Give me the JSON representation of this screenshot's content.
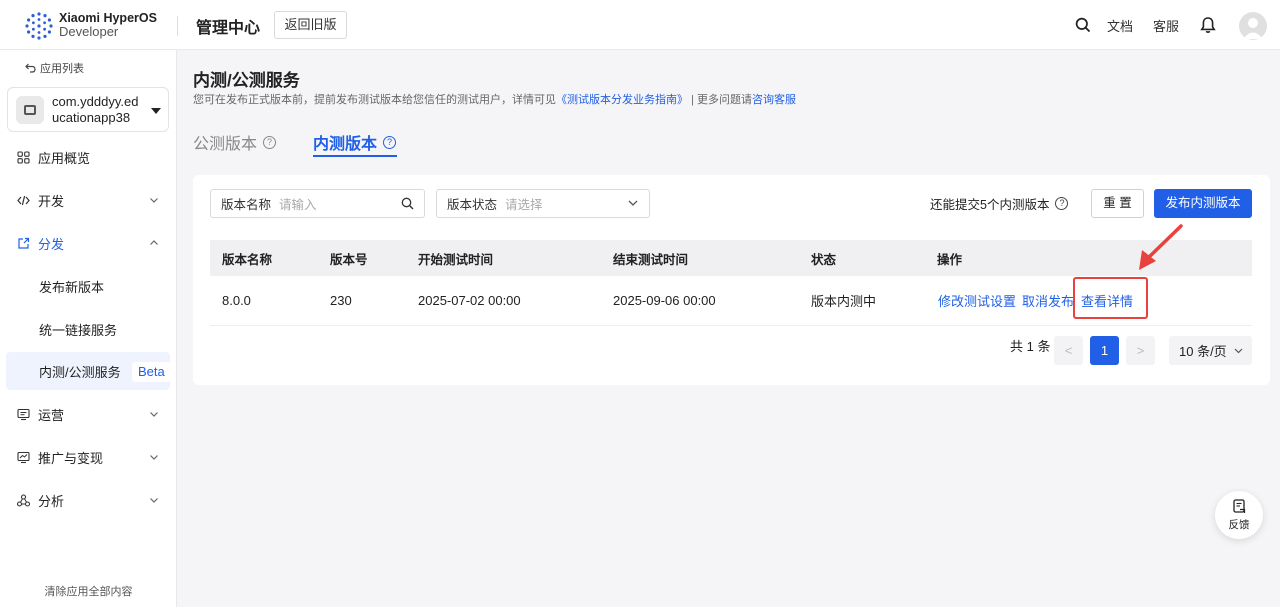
{
  "header": {
    "logo_line1": "Xiaomi HyperOS",
    "logo_line2": "Developer",
    "brand": "管理中心",
    "old_version_button": "返回旧版",
    "docs": "文档",
    "support": "客服"
  },
  "sidebar": {
    "back": "应用列表",
    "app_name_line1": "com.ydddyy.ed",
    "app_name_line2": "ucationapp38",
    "items": [
      {
        "label": "应用概览",
        "icon": "grid-icon"
      },
      {
        "label": "开发",
        "icon": "code-icon"
      },
      {
        "label": "分发",
        "icon": "share-icon"
      },
      {
        "label": "发布新版本"
      },
      {
        "label": "统一链接服务"
      },
      {
        "label": "内测/公测服务",
        "badge": "Beta"
      },
      {
        "label": "运营",
        "icon": "monitor-icon"
      },
      {
        "label": "推广与变现",
        "icon": "chart-screen-icon"
      },
      {
        "label": "分析",
        "icon": "nodes-icon"
      }
    ],
    "clear_all": "清除应用全部内容"
  },
  "page": {
    "title": "内测/公测服务",
    "desc_prefix": "您可在发布正式版本前，提前发布测试版本给您信任的测试用户，详情可见",
    "desc_link": "《测试版本分发业务指南》",
    "desc_mid": " | 更多问题请",
    "desc_link2": "咨询客服",
    "tabs": [
      {
        "label": "公测版本"
      },
      {
        "label": "内测版本"
      }
    ]
  },
  "filters": {
    "name_label": "版本名称",
    "name_placeholder": "请输入",
    "status_label": "版本状态",
    "status_placeholder": "请选择",
    "remaining": "还能提交5个内测版本",
    "reset": "重 置",
    "publish": "发布内测版本"
  },
  "table": {
    "headers": [
      "版本名称",
      "版本号",
      "开始测试时间",
      "结束测试时间",
      "状态",
      "操作"
    ],
    "rows": [
      {
        "name": "8.0.0",
        "code": "230",
        "start": "2025-07-02 00:00",
        "end": "2025-09-06 00:00",
        "status": "版本内测中",
        "actions": [
          "修改测试设置",
          "取消发布",
          "查看详情"
        ]
      }
    ]
  },
  "pagination": {
    "total": "共 1 条",
    "prev": "<",
    "current": "1",
    "next": ">",
    "page_size": "10 条/页"
  },
  "feedback": "反馈",
  "colors": {
    "accent": "#2160e6",
    "highlight": "#e8413e"
  }
}
